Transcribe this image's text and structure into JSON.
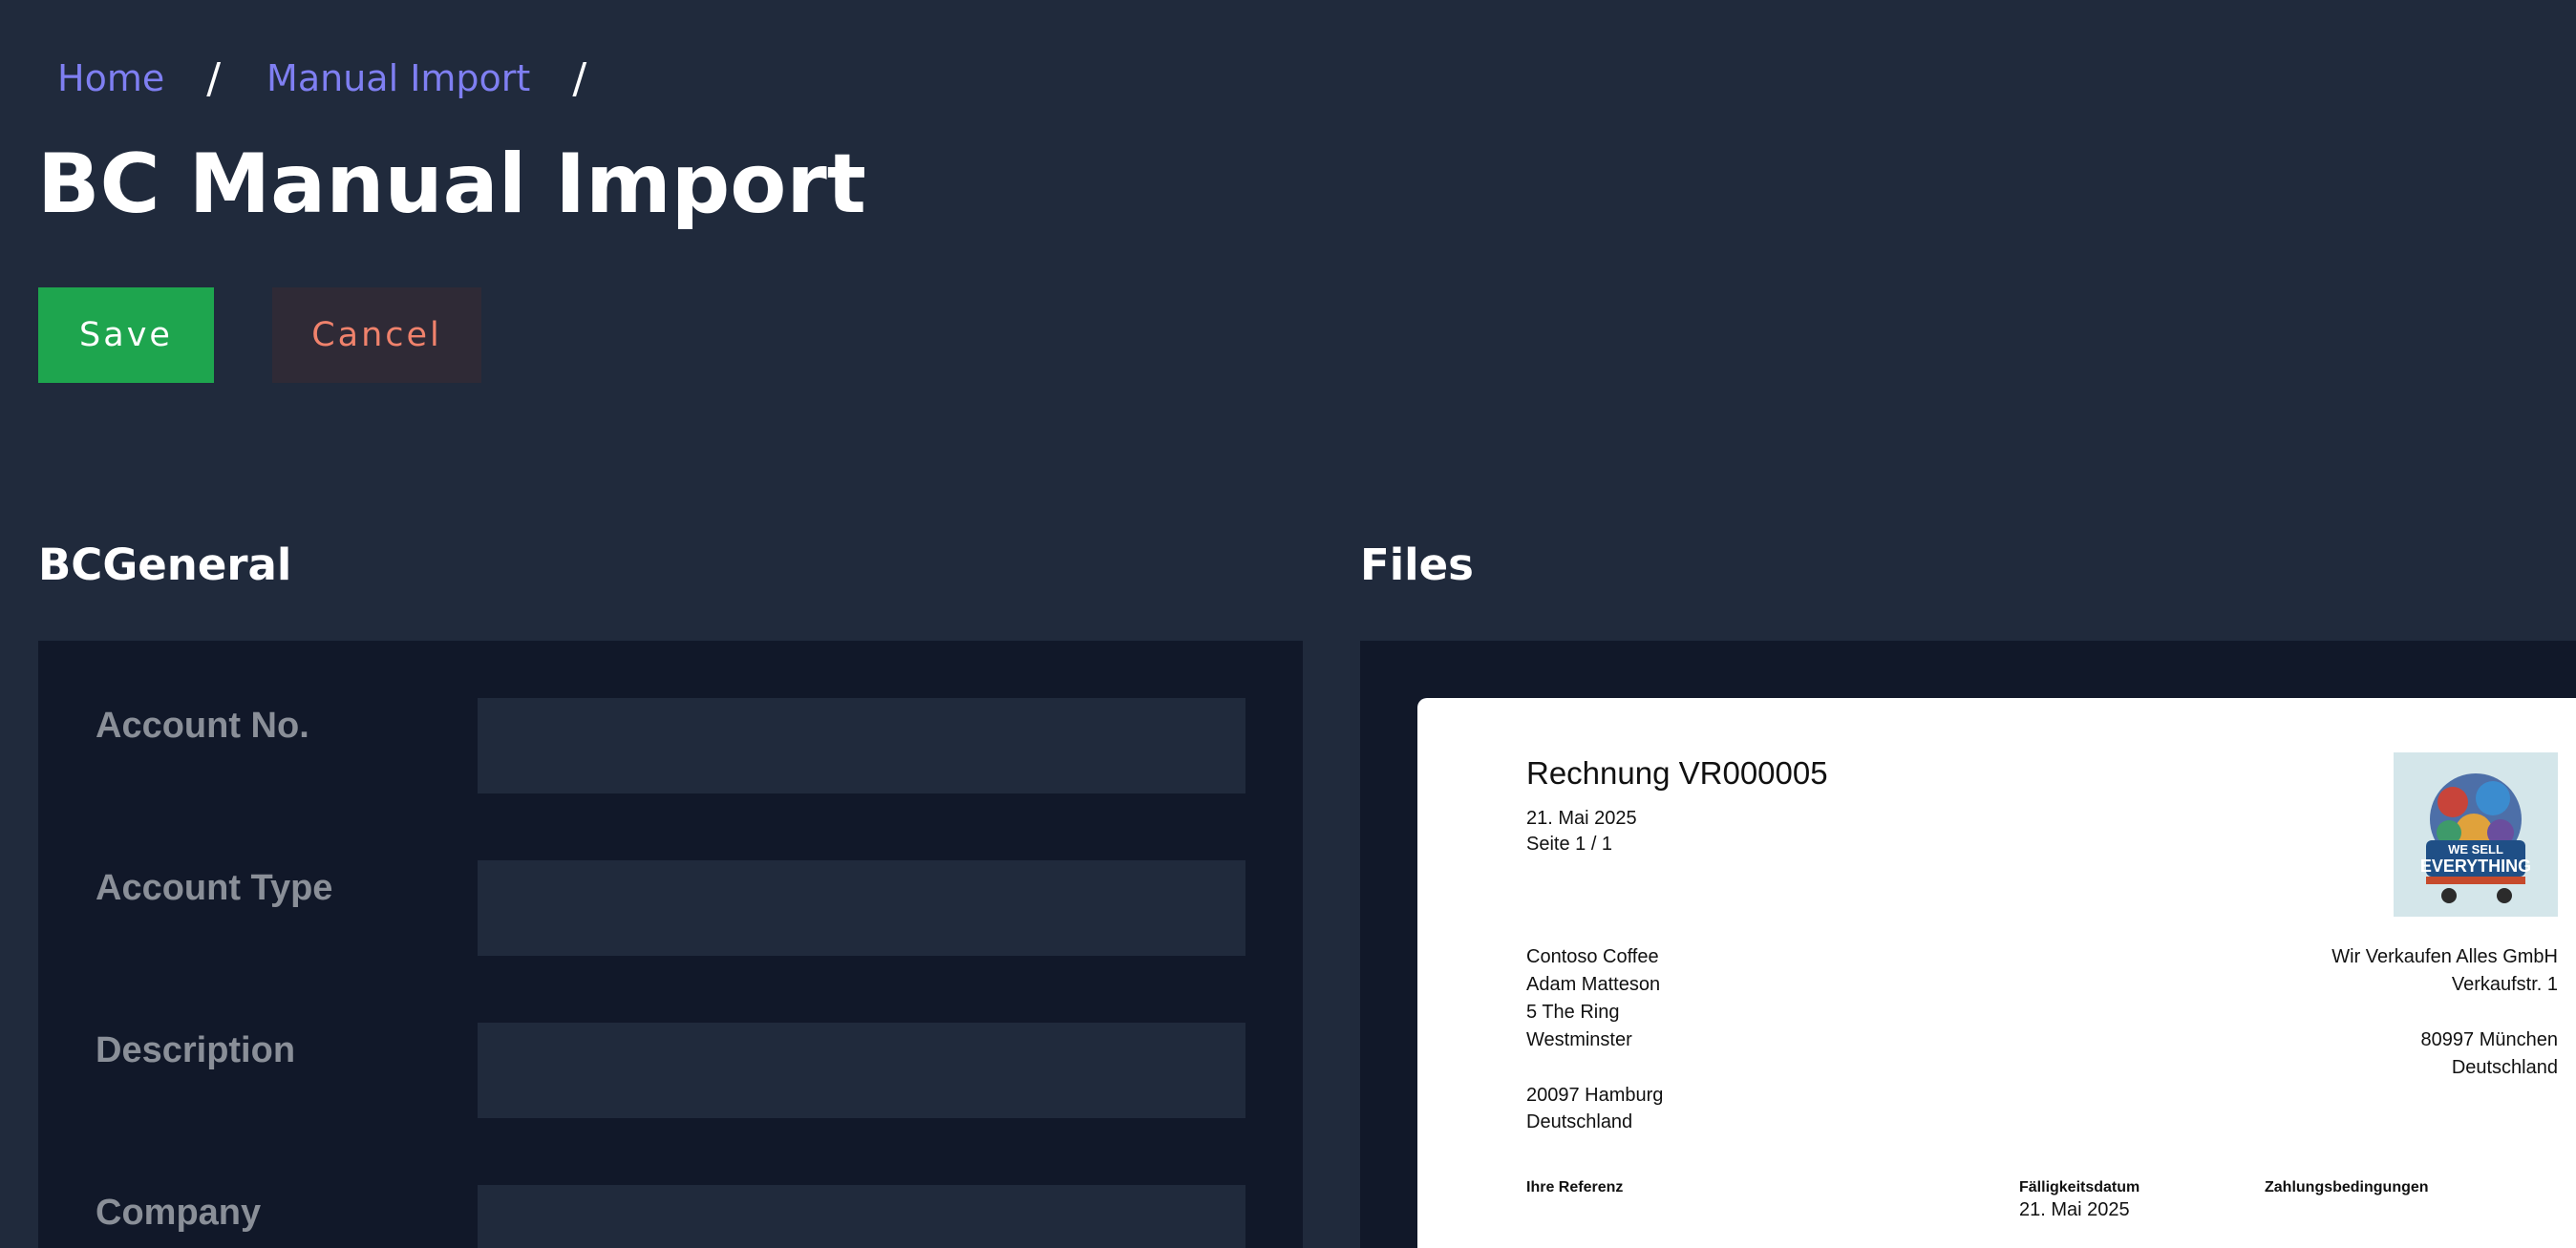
{
  "breadcrumb": {
    "items": [
      {
        "label": "Home"
      },
      {
        "label": "Manual Import"
      }
    ],
    "separator": "/"
  },
  "page": {
    "title": "BC Manual Import"
  },
  "actions": {
    "save_label": "Save",
    "cancel_label": "Cancel"
  },
  "sections": {
    "general_title": "BCGeneral",
    "files_title": "Files"
  },
  "form": {
    "fields": [
      {
        "label": "Account No.",
        "value": ""
      },
      {
        "label": "Account Type",
        "value": ""
      },
      {
        "label": "Description",
        "value": ""
      },
      {
        "label": "Company",
        "value": ""
      }
    ]
  },
  "document": {
    "title": "Rechnung VR000005",
    "date": "21. Mai 2025",
    "page": "Seite  1 / 1",
    "logo_text_line1": "WE SELL",
    "logo_text_line2": "EVERYTHING",
    "recipient": {
      "line1": "Contoso Coffee",
      "line2": "Adam Matteson",
      "line3": "5 The Ring",
      "line4": "Westminster",
      "line5": "20097 Hamburg",
      "line6": "Deutschland"
    },
    "sender": {
      "line1": "Wir Verkaufen Alles GmbH",
      "line2": "Verkaufstr. 1",
      "line3": "80997 München",
      "line4": "Deutschland"
    },
    "labels": {
      "reference": "Ihre Referenz",
      "due_date": "Fälligkeitsdatum",
      "terms": "Zahlungsbedingungen"
    },
    "due_date_value": "21. Mai 2025"
  },
  "colors": {
    "background": "#202a3c",
    "panel": "#111829",
    "link": "#7f7ff2",
    "save": "#1ea54e",
    "cancel_text": "#f0826c"
  }
}
